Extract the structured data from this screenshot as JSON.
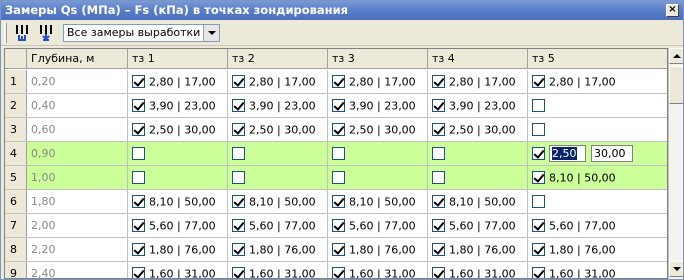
{
  "window": {
    "title": "Замеры Qs (МПа) – Fs (кПа) в точках зондирования",
    "close": "×"
  },
  "toolbar": {
    "combo_value": "Все замеры выработки",
    "btn_add_icon": "add-column-icon",
    "btn_remove_icon": "remove-column-icon"
  },
  "grid": {
    "headers": [
      "",
      "Глубина, м",
      "тз 1",
      "тз 2",
      "тз 3",
      "тз 4",
      "тз 5"
    ],
    "rows": [
      {
        "n": "1",
        "depth": "0,20",
        "hl": false,
        "cells": [
          {
            "on": true,
            "v": "2,80 | 17,00"
          },
          {
            "on": true,
            "v": "2,80 | 17,00"
          },
          {
            "on": true,
            "v": "2,80 | 17,00"
          },
          {
            "on": true,
            "v": "2,80 | 17,00"
          },
          {
            "on": true,
            "v": "2,80 | 17,00"
          }
        ]
      },
      {
        "n": "2",
        "depth": "0,40",
        "hl": false,
        "cells": [
          {
            "on": true,
            "v": "3,90 | 23,00"
          },
          {
            "on": true,
            "v": "3,90 | 23,00"
          },
          {
            "on": true,
            "v": "3,90 | 23,00"
          },
          {
            "on": true,
            "v": "3,90 | 23,00"
          },
          {
            "on": false,
            "v": ""
          }
        ]
      },
      {
        "n": "3",
        "depth": "0,60",
        "hl": false,
        "cells": [
          {
            "on": true,
            "v": "2,50 | 30,00"
          },
          {
            "on": true,
            "v": "2,50 | 30,00"
          },
          {
            "on": true,
            "v": "2,50 | 30,00"
          },
          {
            "on": true,
            "v": "2,50 | 30,00"
          },
          {
            "on": false,
            "v": ""
          }
        ]
      },
      {
        "n": "4",
        "depth": "0,90",
        "hl": true,
        "cells": [
          {
            "on": false,
            "v": ""
          },
          {
            "on": false,
            "v": ""
          },
          {
            "on": false,
            "v": ""
          },
          {
            "on": false,
            "v": ""
          },
          {
            "on": true,
            "v": "",
            "edit": [
              "2,50",
              "30,00"
            ]
          }
        ]
      },
      {
        "n": "5",
        "depth": "1,00",
        "hl": true,
        "cells": [
          {
            "on": false,
            "v": ""
          },
          {
            "on": false,
            "v": ""
          },
          {
            "on": false,
            "v": ""
          },
          {
            "on": false,
            "v": ""
          },
          {
            "on": true,
            "v": "8,10 | 50,00"
          }
        ]
      },
      {
        "n": "6",
        "depth": "1,80",
        "hl": false,
        "cells": [
          {
            "on": true,
            "v": "8,10 | 50,00"
          },
          {
            "on": true,
            "v": "8,10 | 50,00"
          },
          {
            "on": true,
            "v": "8,10 | 50,00"
          },
          {
            "on": true,
            "v": "8,10 | 50,00"
          },
          {
            "on": false,
            "v": ""
          }
        ]
      },
      {
        "n": "7",
        "depth": "2,00",
        "hl": false,
        "cells": [
          {
            "on": true,
            "v": "5,60 | 77,00"
          },
          {
            "on": true,
            "v": "5,60 | 77,00"
          },
          {
            "on": true,
            "v": "5,60 | 77,00"
          },
          {
            "on": true,
            "v": "5,60 | 77,00"
          },
          {
            "on": true,
            "v": "5,60 | 77,00"
          }
        ]
      },
      {
        "n": "8",
        "depth": "2,20",
        "hl": false,
        "cells": [
          {
            "on": true,
            "v": "1,80 | 76,00"
          },
          {
            "on": true,
            "v": "1,80 | 76,00"
          },
          {
            "on": true,
            "v": "1,80 | 76,00"
          },
          {
            "on": true,
            "v": "1,80 | 76,00"
          },
          {
            "on": true,
            "v": "1,80 | 76,00"
          }
        ]
      },
      {
        "n": "9",
        "depth": "2,40",
        "hl": false,
        "cells": [
          {
            "on": true,
            "v": "1,60 | 31,00"
          },
          {
            "on": true,
            "v": "1,60 | 31,00"
          },
          {
            "on": true,
            "v": "1,60 | 31,00"
          },
          {
            "on": true,
            "v": "1,60 | 31,00"
          },
          {
            "on": true,
            "v": "1,60 | 31,00"
          }
        ]
      }
    ]
  }
}
